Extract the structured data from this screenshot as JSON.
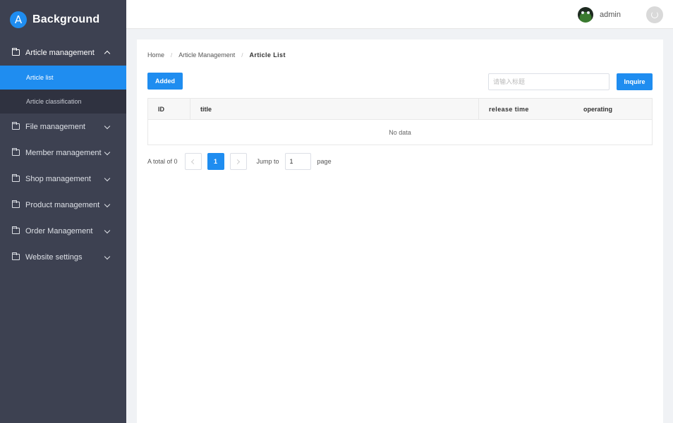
{
  "brand": {
    "logo_letter": "A",
    "title": "Background"
  },
  "sidebar": {
    "groups": [
      {
        "label": "Article management",
        "open": true,
        "items": [
          {
            "label": "Article list",
            "active": true
          },
          {
            "label": "Article classification",
            "active": false
          }
        ]
      },
      {
        "label": "File management"
      },
      {
        "label": "Member management"
      },
      {
        "label": "Shop management"
      },
      {
        "label": "Product management"
      },
      {
        "label": "Order Management"
      },
      {
        "label": "Website settings"
      }
    ]
  },
  "header": {
    "username": "admin"
  },
  "breadcrumb": {
    "items": [
      "Home",
      "Article Management",
      "Article List"
    ],
    "separator": "/"
  },
  "toolbar": {
    "add_label": "Added",
    "search_placeholder": "请输入标题",
    "search_value": "",
    "inquire_label": "Inquire"
  },
  "table": {
    "columns": [
      "ID",
      "title",
      "release time",
      "operating"
    ],
    "empty_text": "No data"
  },
  "pagination": {
    "total_label": "A total of 0",
    "current_page": "1",
    "jump_label": "Jump to",
    "jump_value": "1",
    "page_label": "page"
  },
  "colors": {
    "accent": "#1f8df0",
    "sidebar_bg": "#3d4151",
    "submenu_bg": "#2f3240"
  }
}
